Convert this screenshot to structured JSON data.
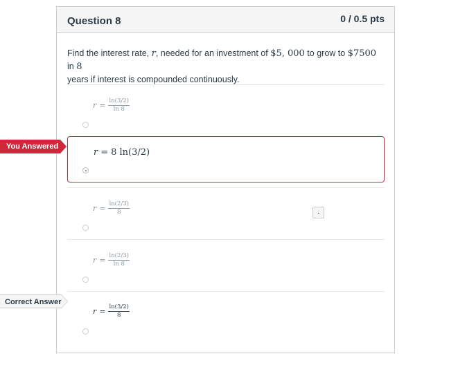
{
  "question": {
    "title": "Question 8",
    "points": "0 / 0.5 pts",
    "text_parts": {
      "t1": "Find the interest rate, ",
      "var": "r",
      "t2": ", needed for an investment of ",
      "amount1": "$5, 000",
      "t3": " to grow to ",
      "amount2": "$7500",
      "t4": " in ",
      "years": "8",
      "t5": "years if interest is compounded continuously."
    }
  },
  "answers": [
    {
      "var": "r",
      "eq": "=",
      "num": "ln(3/2)",
      "den": "ln 8",
      "selected": false
    },
    {
      "var": "r",
      "eq": "=",
      "expr": "8 ln(3/2)",
      "selected": true
    },
    {
      "var": "r",
      "eq": "=",
      "num": "ln(2/3)",
      "den": "8",
      "selected": false
    },
    {
      "var": "r",
      "eq": "=",
      "num": "ln(2/3)",
      "den": "ln 8",
      "selected": false
    },
    {
      "var": "r",
      "eq": "=",
      "num": "ln(3/2)",
      "den": "8",
      "selected": false
    }
  ],
  "flags": {
    "you_answered": "You Answered",
    "correct_answer": "Correct Answer"
  },
  "comment_button": {
    "label": "."
  },
  "colors": {
    "wrong": "#d0273c",
    "text": "#2d3b45",
    "muted": "#8b969e",
    "border": "#c7cdd1"
  }
}
